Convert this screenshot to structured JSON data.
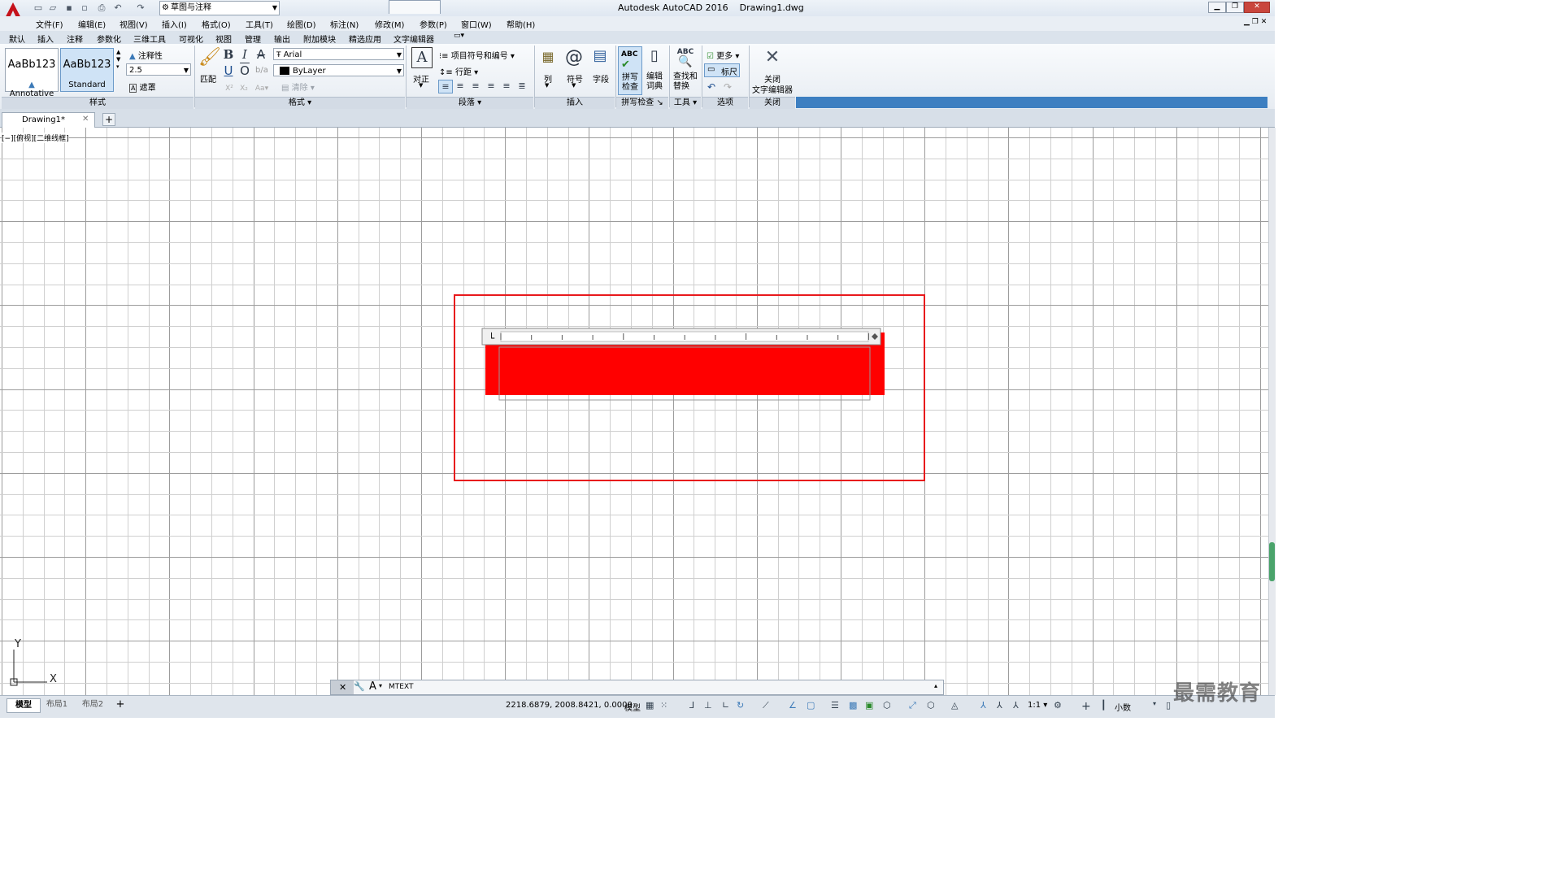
{
  "titlebar": {
    "workspace": "草图与注释",
    "app": "Autodesk AutoCAD 2016",
    "file": "Drawing1.dwg"
  },
  "menu": [
    "文件(F)",
    "编辑(E)",
    "视图(V)",
    "插入(I)",
    "格式(O)",
    "工具(T)",
    "绘图(D)",
    "标注(N)",
    "修改(M)",
    "参数(P)",
    "窗口(W)",
    "帮助(H)"
  ],
  "ribbon_tabs": [
    "默认",
    "插入",
    "注释",
    "参数化",
    "三维工具",
    "可视化",
    "视图",
    "管理",
    "输出",
    "附加模块",
    "精选应用",
    "文字编辑器"
  ],
  "ribbon": {
    "style": {
      "annotative_sample": "AaBb123",
      "annotative_name": "Annotative",
      "standard_sample": "AaBb123",
      "standard_name": "Standard",
      "annotative_toggle": "注释性",
      "height_value": "2.5",
      "mask": "遮罩",
      "panel": "样式"
    },
    "format": {
      "match": "匹配",
      "bold": "B",
      "italic": "I",
      "strike": "A",
      "underline": "U",
      "overline": "O",
      "font": "Arial",
      "color": "ByLayer",
      "clear": "清除",
      "case": "Aa",
      "panel": "格式"
    },
    "paragraph": {
      "justify": "对正",
      "bullets": "项目符号和编号",
      "line_spacing": "行距",
      "panel": "段落"
    },
    "insert": {
      "columns": "列",
      "symbol": "符号",
      "field": "字段",
      "panel": "插入"
    },
    "spell": {
      "check": "拼写\n检查",
      "dictionary": "编辑\n词典",
      "panel": "拼写检查"
    },
    "tools": {
      "find": "查找和\n替换",
      "panel": "工具"
    },
    "options": {
      "more": "更多",
      "ruler": "标尺",
      "panel": "选项"
    },
    "close": {
      "label_1": "关闭",
      "label_2": "文字编辑器",
      "panel": "关闭"
    }
  },
  "doc_tab": "Drawing1*",
  "viewport_label": "[−][俯视][二维线框]",
  "cmdline": {
    "text": "MTEXT"
  },
  "layout_tabs": [
    "模型",
    "布局1",
    "布局2"
  ],
  "status": {
    "coords": "2218.6879, 2008.8421, 0.0000",
    "model": "模型",
    "scale": "1:1",
    "units": "小数"
  },
  "watermark": "最需教育",
  "colors": {
    "text_fill": "#ff0000",
    "selection_border": "#e8191c",
    "grid": "#c8c8c8",
    "accent": "#3c7ab8"
  }
}
